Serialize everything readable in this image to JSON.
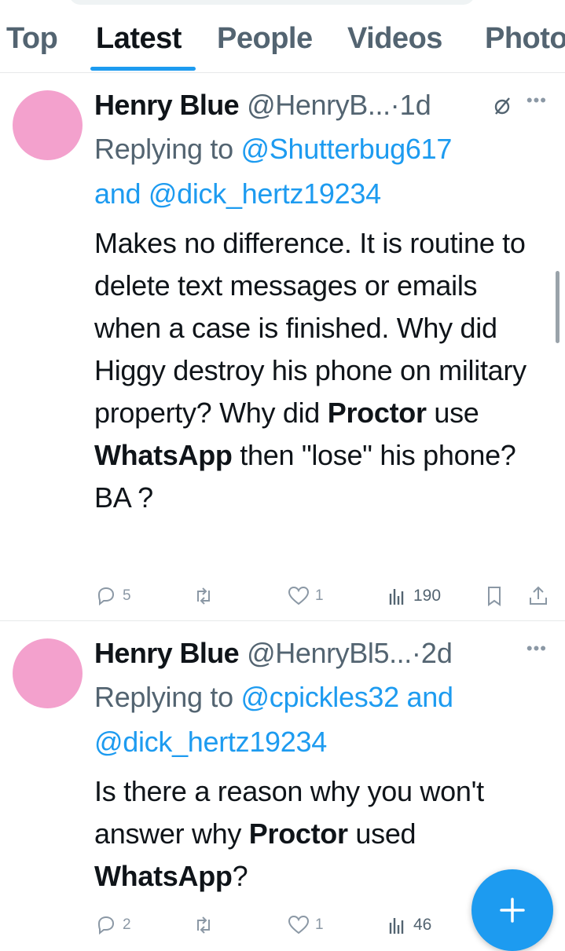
{
  "tabs": [
    {
      "label": "Top"
    },
    {
      "label": "Latest"
    },
    {
      "label": "People"
    },
    {
      "label": "Videos"
    },
    {
      "label": "Photos"
    }
  ],
  "active_tab": "Latest",
  "tweets": [
    {
      "name": "Henry Blue",
      "handle": "@HenryB...",
      "time": "1d",
      "replying_prefix": "Replying to",
      "mention1": "@Shutterbug617",
      "and": "and",
      "mention2": "@dick_hertz19234",
      "body": [
        {
          "text": "Makes no difference. It is routine to delete text messages or emails when a case is finished. Why did Higgy destroy his phone on military property? Why did ",
          "bold": false
        },
        {
          "text": "Proctor",
          "bold": true
        },
        {
          "text": " use ",
          "bold": false
        },
        {
          "text": "WhatsApp",
          "bold": true
        },
        {
          "text": " then \"lose\" his phone?BA ?",
          "bold": false
        }
      ],
      "replies": "5",
      "retweets": "",
      "likes": "1",
      "views": "190"
    },
    {
      "name": "Henry Blue",
      "handle": "@HenryBl5...",
      "time": "2d",
      "replying_prefix": "Replying to",
      "mention1": "@cpickles32",
      "and": "and",
      "mention2": "@dick_hertz19234",
      "body": [
        {
          "text": "Is there a reason why you won't answer why ",
          "bold": false
        },
        {
          "text": "Proctor",
          "bold": true
        },
        {
          "text": " used ",
          "bold": false
        },
        {
          "text": "WhatsApp",
          "bold": true
        },
        {
          "text": "?",
          "bold": false
        }
      ],
      "replies": "2",
      "retweets": "",
      "likes": "1",
      "views": "46"
    }
  ],
  "colors": {
    "accent": "#1d9bf0",
    "avatar": "#f3a1cd",
    "muted": "#536471"
  }
}
